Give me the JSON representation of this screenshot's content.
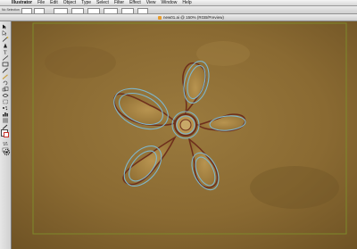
{
  "app": {
    "apple_glyph": "",
    "name": "Illustrator"
  },
  "menubar": {
    "items": [
      {
        "label": "File"
      },
      {
        "label": "Edit"
      },
      {
        "label": "Object"
      },
      {
        "label": "Type"
      },
      {
        "label": "Select"
      },
      {
        "label": "Filter"
      },
      {
        "label": "Effect"
      },
      {
        "label": "View"
      },
      {
        "label": "Window"
      },
      {
        "label": "Help"
      }
    ]
  },
  "control_panel": {
    "first_label": "No Selection"
  },
  "document": {
    "title": "new01.ai @ 150% (RGB/Preview)",
    "artboard_border_color": "#7d8a2a"
  },
  "artwork": {
    "description_icon": "flower-outline",
    "outline_color": "#7fb6cc",
    "stem_color": "#6e2e1c",
    "background_color": "#8a6a32"
  }
}
